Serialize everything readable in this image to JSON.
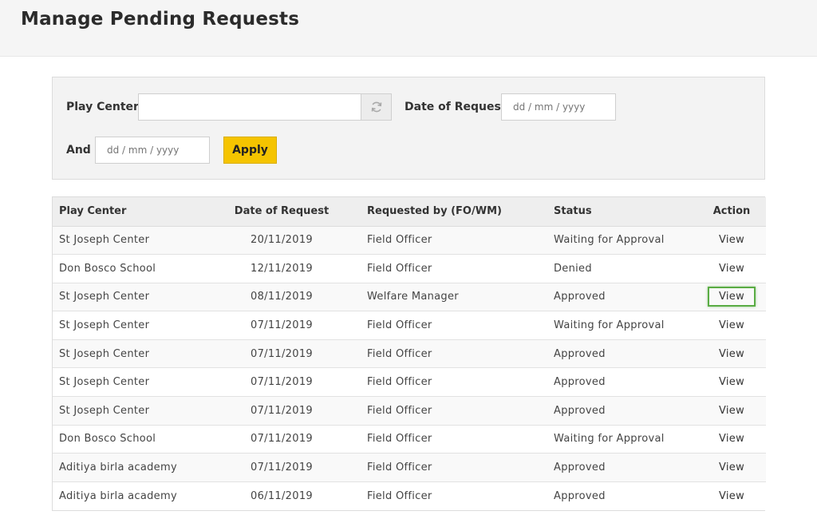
{
  "page": {
    "title": "Manage Pending Requests"
  },
  "filters": {
    "play_center_label": "Play Center",
    "play_center_value": "",
    "date_label": "Date of Request",
    "date_from_placeholder": "dd / mm / yyyy",
    "and_label": "And",
    "date_to_placeholder": "dd / mm / yyyy",
    "apply_label": "Apply",
    "refresh_icon": "refresh-icon"
  },
  "colors": {
    "apply_bg": "#f5c400",
    "focus_ring": "#5aac44"
  },
  "table": {
    "headers": [
      "Play Center",
      "Date of Request",
      "Requested by (FO/WM)",
      "Status",
      "Action"
    ],
    "rows": [
      [
        "St Joseph Center",
        "20/11/2019",
        "Field Officer",
        "Waiting for Approval",
        "View"
      ],
      [
        "Don Bosco School",
        "12/11/2019",
        "Field Officer",
        "Denied",
        "View"
      ],
      [
        "St Joseph Center",
        "08/11/2019",
        "Welfare Manager",
        "Approved",
        "View"
      ],
      [
        "St Joseph Center",
        "07/11/2019",
        "Field Officer",
        "Waiting for Approval",
        "View"
      ],
      [
        "St Joseph Center",
        "07/11/2019",
        "Field Officer",
        "Approved",
        "View"
      ],
      [
        "St Joseph Center",
        "07/11/2019",
        "Field Officer",
        "Approved",
        "View"
      ],
      [
        "St Joseph Center",
        "07/11/2019",
        "Field Officer",
        "Approved",
        "View"
      ],
      [
        "Don Bosco School",
        "07/11/2019",
        "Field Officer",
        "Waiting for Approval",
        "View"
      ],
      [
        "Aditiya birla academy",
        "07/11/2019",
        "Field Officer",
        "Approved",
        "View"
      ],
      [
        "Aditiya birla academy",
        "06/11/2019",
        "Field Officer",
        "Approved",
        "View"
      ]
    ],
    "focused_row": 2
  }
}
